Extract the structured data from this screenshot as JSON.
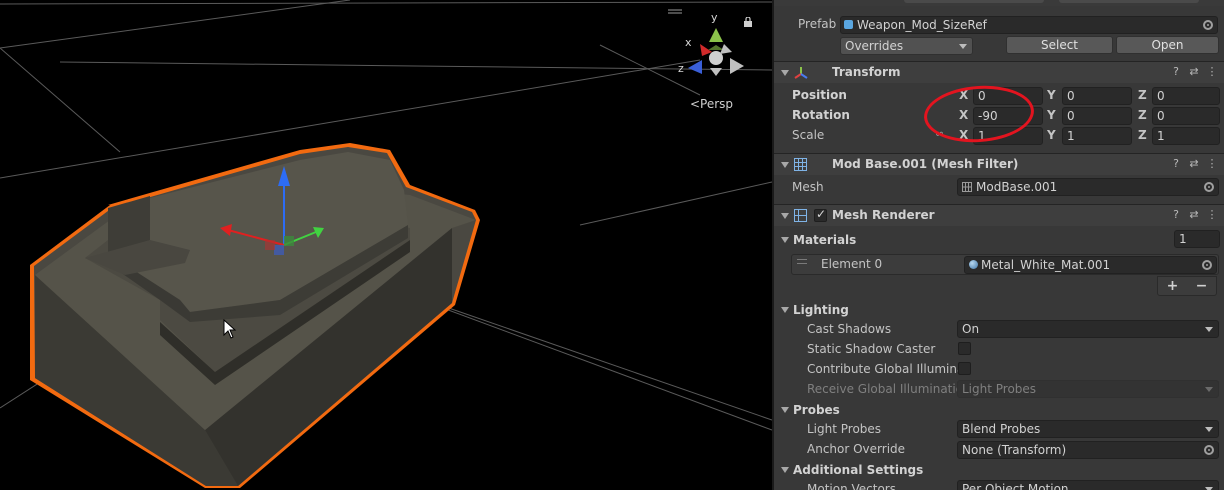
{
  "scene": {
    "persp_label": "<Persp",
    "gizmo": {
      "x_label": "x",
      "y_label": "y",
      "z_label": "z"
    }
  },
  "inspector": {
    "prefab": {
      "label": "Prefab",
      "value": "Weapon_Mod_SizeRef",
      "overrides": "Overrides",
      "select": "Select",
      "open": "Open"
    },
    "transform": {
      "title": "Transform",
      "position": {
        "label": "Position",
        "x": "0",
        "y": "0",
        "z": "0"
      },
      "rotation": {
        "label": "Rotation",
        "x": "-90",
        "y": "0",
        "z": "0"
      },
      "scale": {
        "label": "Scale",
        "x": "1",
        "y": "1",
        "z": "1"
      },
      "axes": {
        "x": "X",
        "y": "Y",
        "z": "Z"
      }
    },
    "mesh_filter": {
      "title": "Mod Base.001 (Mesh Filter)",
      "mesh_label": "Mesh",
      "mesh_value": "ModBase.001"
    },
    "mesh_renderer": {
      "title": "Mesh Renderer",
      "materials_label": "Materials",
      "materials_count": "1",
      "element_label": "Element 0",
      "element_value": "Metal_White_Mat.001",
      "plus": "+",
      "minus": "−"
    },
    "lighting": {
      "title": "Lighting",
      "cast_shadows_label": "Cast Shadows",
      "cast_shadows_value": "On",
      "static_shadow_label": "Static Shadow Caster",
      "contribute_gi_label": "Contribute Global Illumina",
      "receive_gi_label": "Receive Global Illuminatio",
      "receive_gi_value": "Light Probes"
    },
    "probes": {
      "title": "Probes",
      "light_probes_label": "Light Probes",
      "light_probes_value": "Blend Probes",
      "anchor_label": "Anchor Override",
      "anchor_value": "None (Transform)"
    },
    "additional": {
      "title": "Additional Settings",
      "motion_label": "Motion Vectors",
      "motion_value": "Per Object Motion"
    }
  },
  "colors": {
    "selection_outline": "#f26a10",
    "annotation_circle": "#e3141f",
    "inspector_bg": "#383838"
  }
}
